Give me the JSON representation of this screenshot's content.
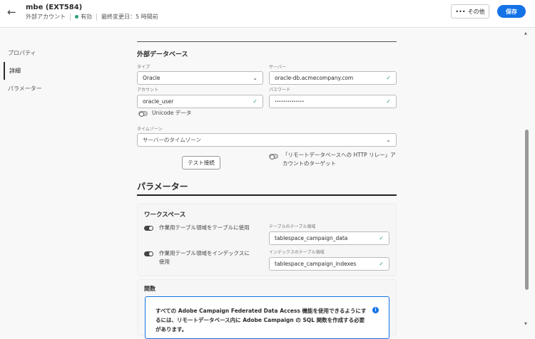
{
  "header": {
    "title": "mbe (EXT584)",
    "type": "外部アカウント",
    "status": "有効",
    "modified": "最終変更日：5 時間前",
    "more_label": "その他",
    "save_label": "保存"
  },
  "sidebar": {
    "items": [
      {
        "label": "プロパティ"
      },
      {
        "label": "詳細"
      },
      {
        "label": "パラメーター"
      }
    ]
  },
  "external_db": {
    "heading": "外部データベース",
    "type_label": "タイプ",
    "type_value": "Oracle",
    "server_label": "サーバー",
    "server_value": "oracle-db.acmecompany.com",
    "account_label": "アカウント",
    "account_value": "oracle_user",
    "password_label": "パスワード",
    "password_value": "••••••••••••••",
    "unicode_label": "Unicode データ",
    "timezone_label": "タイムゾーン",
    "timezone_value": "サーバーのタイムゾーン",
    "test_label": "テスト接続",
    "http_relay_label": "「リモートデータベースへの HTTP リレー」アカウントのターゲット"
  },
  "params": {
    "heading": "パラメーター",
    "workspace_heading": "ワークスペース",
    "use_table_label": "作業用テーブル領域をテーブルに使用",
    "table_ts_label": "テーブルのテーブル領域",
    "table_ts_value": "tablespace_campaign_data",
    "use_index_label": "作業用テーブル領域をインデックスに使用",
    "index_ts_label": "インデックスのテーブル領域",
    "index_ts_value": "tablespace_campaign_indexes",
    "functions_heading": "関数",
    "info_text": "すべての Adobe Campaign Federated Data Access 機能を使用できるようにするには、リモートデータベース内に Adobe Campaign の SQL 関数を作成する必要があります。"
  }
}
